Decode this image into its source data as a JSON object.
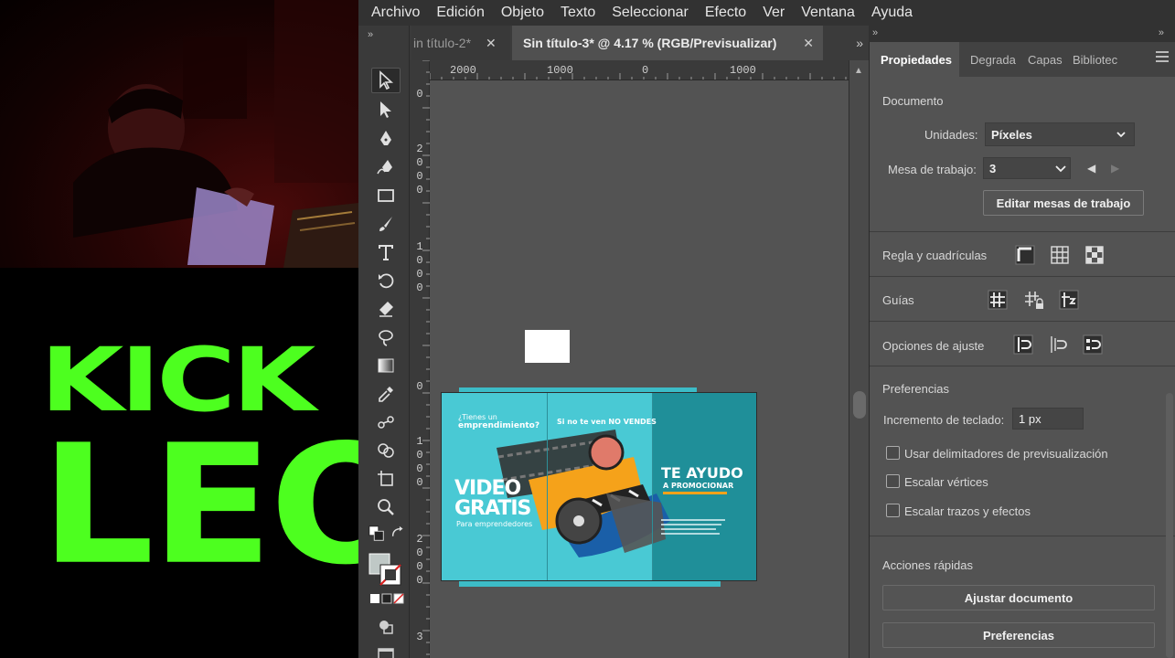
{
  "menu": [
    "Archivo",
    "Edición",
    "Objeto",
    "Texto",
    "Seleccionar",
    "Efecto",
    "Ver",
    "Ventana",
    "Ayuda"
  ],
  "brand": {
    "line1": "KICK",
    "line2": "LEO",
    "color": "#4dff1f"
  },
  "tabs": [
    {
      "label": "in título-2*",
      "close": "✕",
      "active": false
    },
    {
      "label": "Sin título-3* @ 4.17 % (RGB/Previsualizar)",
      "close": "✕",
      "active": true
    }
  ],
  "tab_overflow": "»",
  "ruler": {
    "horizontal": [
      "2000",
      "1000",
      "0",
      "1000"
    ],
    "vertical": [
      [
        "0"
      ],
      [
        "2",
        "0",
        "0",
        "0"
      ],
      [
        "1",
        "0",
        "0",
        "0"
      ],
      [
        "0"
      ],
      [
        "1",
        "0",
        "0",
        "0"
      ],
      [
        "2",
        "0",
        "0",
        "0"
      ],
      [
        "3"
      ]
    ]
  },
  "artwork": {
    "left_small": "¿Tienes un",
    "left_big": "emprendimiento?",
    "video": "VIDEO",
    "gratis": "GRATIS",
    "para": "Para emprendedores",
    "middle": "Si no te ven NO VENDES",
    "right_1": "TE AYUDO",
    "right_2": "A PROMOCIONAR",
    "accent": "#f5a21a",
    "background": "#49c9d4"
  },
  "panel": {
    "tabs": [
      "Propiedades",
      "Degrada",
      "Capas",
      "Bibliotec"
    ],
    "documento": "Documento",
    "unidades_label": "Unidades:",
    "unidades_value": "Píxeles",
    "mesa_label": "Mesa de trabajo:",
    "mesa_value": "3",
    "editar_btn": "Editar mesas de trabajo",
    "regla": "Regla y cuadrículas",
    "guias": "Guías",
    "ajuste": "Opciones de ajuste",
    "preferencias": "Preferencias",
    "incremento_label": "Incremento de teclado:",
    "incremento_value": "1 px",
    "chk1": "Usar delimitadores de previsualización",
    "chk2": "Escalar vértices",
    "chk3": "Escalar trazos y efectos",
    "acciones": "Acciones rápidas",
    "ajustar_btn": "Ajustar documento",
    "pref_btn": "Preferencias"
  },
  "tools": [
    "selection-tool-icon",
    "direct-selection-tool-icon",
    "pen-tool-icon",
    "curvature-tool-icon",
    "rectangle-tool-icon",
    "paintbrush-tool-icon",
    "type-tool-icon",
    "rotate-tool-icon",
    "eraser-tool-icon",
    "lasso-tool-icon",
    "gradient-tool-icon",
    "eyedropper-tool-icon",
    "blend-tool-icon",
    "shape-builder-tool-icon",
    "artboard-tool-icon",
    "zoom-tool-icon"
  ]
}
